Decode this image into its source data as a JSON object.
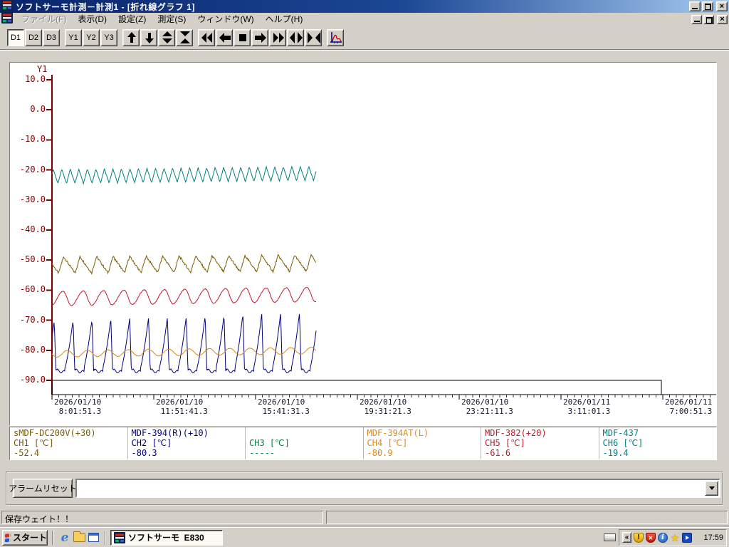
{
  "window": {
    "title": "ソフトサーモ計測－計測1 - [折れ線グラフ 1]"
  },
  "menu": {
    "items": [
      {
        "key": "file",
        "label": "ファイル(F)",
        "disabled": true
      },
      {
        "key": "view",
        "label": "表示(D)",
        "disabled": false
      },
      {
        "key": "settings",
        "label": "設定(Z)",
        "disabled": false
      },
      {
        "key": "measure",
        "label": "測定(S)",
        "disabled": false
      },
      {
        "key": "window",
        "label": "ウィンドウ(W)",
        "disabled": false
      },
      {
        "key": "help",
        "label": "ヘルプ(H)",
        "disabled": false
      }
    ]
  },
  "toolbar": {
    "text_buttons": [
      "D1",
      "D2",
      "D3",
      "Y1",
      "Y2",
      "Y3"
    ],
    "pressed": "D1",
    "icon_buttons": [
      "scroll-up",
      "scroll-down",
      "expand-vertical",
      "compress-vertical",
      "fast-left",
      "scroll-left",
      "stop",
      "scroll-right",
      "fast-right",
      "expand-horizontal",
      "compress-horizontal",
      "graph-setup"
    ]
  },
  "chart_data": {
    "type": "line",
    "title": "折れ線グラフ 1",
    "y_axis": {
      "name": "Y1",
      "min": -90,
      "max": 10,
      "step": 10,
      "labels": [
        "10.0",
        "0.0",
        "-10.0",
        "-20.0",
        "-30.0",
        "-40.0",
        "-50.0",
        "-60.0",
        "-70.0",
        "-80.0",
        "-90.0"
      ]
    },
    "x_axis": {
      "labels": [
        [
          "2026/01/10",
          "8:01:51.3"
        ],
        [
          "2026/01/10",
          "11:51:41.3"
        ],
        [
          "2026/01/10",
          "15:41:31.3"
        ],
        [
          "2026/01/10",
          "19:31:21.3"
        ],
        [
          "2026/01/10",
          "23:21:11.3"
        ],
        [
          "2026/01/11",
          "3:11:01.3"
        ],
        [
          "2026/01/11",
          "7:00:51.3"
        ]
      ]
    },
    "data_extent_fraction": 0.433,
    "series": [
      {
        "channel": "CH1",
        "name": "sMDF-DC200V(+30)",
        "unit": "[℃]",
        "value": "-52.4",
        "color": "#7a5c00",
        "waveform": {
          "shape": "sawtooth",
          "cycles": 16,
          "min": -54.4,
          "max": -48.9,
          "trend": 0.6,
          "rise": 0.3,
          "jitter": 0.35,
          "phase": 0.6
        }
      },
      {
        "channel": "CH2",
        "name": "MDF-394(R)(+10)",
        "unit": "[℃]",
        "value": "-80.3",
        "color": "#000080",
        "waveform": {
          "shape": "spike",
          "cycles": 14,
          "min": -86.5,
          "max": -70.3,
          "trend": 3.0,
          "rise": 0.42,
          "jitter": 0,
          "phase": 0.3
        }
      },
      {
        "channel": "CH3",
        "name": "",
        "unit": "[℃]",
        "value": "-----",
        "color": "#008040",
        "waveform": null
      },
      {
        "channel": "CH4",
        "name": "MDF-394AT(L)",
        "unit": "[℃]",
        "value": "-80.9",
        "color": "#e08818",
        "waveform": {
          "shape": "sine",
          "cycles": 13,
          "min": -82.3,
          "max": -80.1,
          "trend": 1.1,
          "rise": 0.5,
          "jitter": 0.08,
          "phase": 0.5
        }
      },
      {
        "channel": "CH5",
        "name": "MDF-382(+20)",
        "unit": "[℃]",
        "value": "-61.6",
        "color": "#c01828",
        "waveform": {
          "shape": "wave",
          "cycles": 13,
          "min": -65.2,
          "max": -60.4,
          "trend": 1.4,
          "rise": 0.6,
          "jitter": 0.1,
          "phase": 0.05
        }
      },
      {
        "channel": "CH6",
        "name": "MDF-437",
        "unit": "[℃]",
        "value": "-19.4",
        "color": "#008080",
        "waveform": {
          "shape": "triangle",
          "cycles": 31,
          "min": -24.6,
          "max": -19.8,
          "trend": 1.0,
          "rise": 0.45,
          "jitter": 0.12,
          "phase": 0.3
        }
      }
    ]
  },
  "alarm": {
    "reset_label": "アラームリセット",
    "combo_value": ""
  },
  "status": {
    "message": "保存ウェイト！！"
  },
  "taskbar": {
    "start_label": "スタート",
    "task_label": "ソフトサーモ  E830",
    "clock": "17:59",
    "quick_launch": [
      "internet-explorer",
      "folder",
      "window-app"
    ],
    "tray_icons": [
      "hide-chevron",
      "security-warning",
      "security-alert",
      "info-balloon",
      "update-star",
      "media-player"
    ]
  }
}
